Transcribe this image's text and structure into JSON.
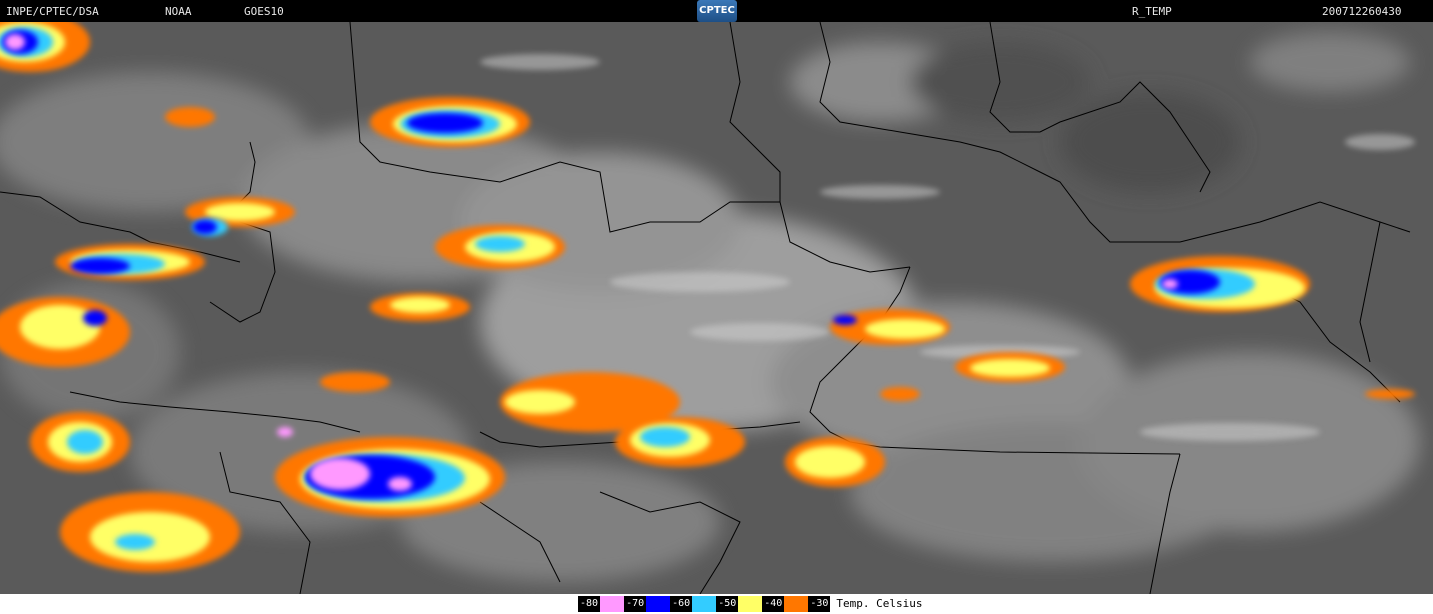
{
  "header": {
    "source": "INPE/CPTEC/DSA",
    "agency": "NOAA",
    "satellite": "GOES10",
    "logo_text": "CPTEC",
    "product": "R_TEMP",
    "timestamp": "200712260430"
  },
  "legend": {
    "unit": "Temp. Celsius",
    "items": [
      {
        "label": "-80",
        "color": "#ff99ff"
      },
      {
        "label": "-70",
        "color": "#0000ff"
      },
      {
        "label": "-60",
        "color": "#33ccff"
      },
      {
        "label": "-50",
        "color": "#ffff66"
      },
      {
        "label": "-40",
        "color": "#ff7700"
      },
      {
        "label": "-30",
        "color": ""
      }
    ]
  },
  "colors": {
    "background": "#5a5a5a",
    "borders": "#000000",
    "cloud": "#cfcfcf"
  }
}
